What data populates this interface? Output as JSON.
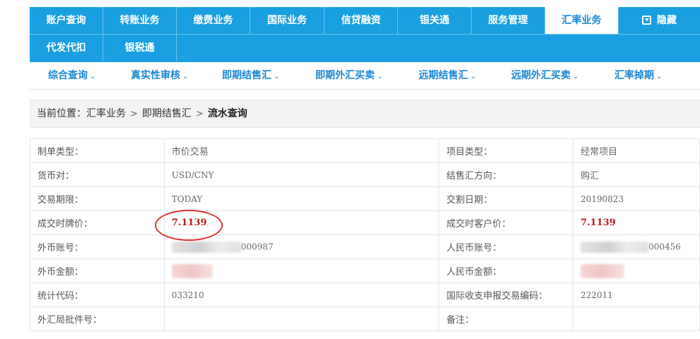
{
  "top_tabs": [
    {
      "label": "账户查询"
    },
    {
      "label": "转账业务"
    },
    {
      "label": "缴费业务"
    },
    {
      "label": "国际业务"
    },
    {
      "label": "信贷融资"
    },
    {
      "label": "银关通"
    },
    {
      "label": "服务管理"
    },
    {
      "label": "汇率业务",
      "active": true
    },
    {
      "label": "隐藏",
      "icon": "collapse-icon"
    },
    {
      "label": "代发代扣"
    },
    {
      "label": "银税通"
    }
  ],
  "sub_nav": [
    {
      "label": "综合查询"
    },
    {
      "label": "真实性审核"
    },
    {
      "label": "即期结售汇"
    },
    {
      "label": "即期外汇买卖"
    },
    {
      "label": "远期结售汇"
    },
    {
      "label": "远期外汇买卖"
    },
    {
      "label": "汇率掉期"
    }
  ],
  "breadcrumb": {
    "prefix": "当前位置：",
    "items": [
      "汇率业务",
      "即期结售汇"
    ],
    "current": "流水查询"
  },
  "detail_rows": [
    {
      "l1": "制单类型：",
      "v1": "市价交易",
      "l2": "项目类型：",
      "v2": "经常项目"
    },
    {
      "l1": "货币对：",
      "v1": "USD/CNY",
      "l2": "结售汇方向：",
      "v2": "购汇"
    },
    {
      "l1": "交易期限：",
      "v1": "TODAY",
      "l2": "交割日期：",
      "v2": "20190823"
    },
    {
      "l1": "成交时牌价：",
      "v1": "7.1139",
      "l2": "成交时客户价：",
      "v2": "7.1139"
    },
    {
      "l1": "外币账号：",
      "v1": "000987",
      "l2": "人民币账号：",
      "v2": "000456"
    },
    {
      "l1": "外币金额：",
      "v1": "",
      "l2": "人民币金额：",
      "v2": ""
    },
    {
      "l1": "统计代码：",
      "v1": "033210",
      "l2": "国际收支申报交易编码：",
      "v2": "222011"
    },
    {
      "l1": "外汇局批件号：",
      "v1": "",
      "l2": "备注：",
      "v2": ""
    }
  ],
  "colors": {
    "nav_blue": "#1a9fe0",
    "link_blue": "#1a88d6",
    "price_red": "#b51d1d",
    "annotation_red": "#e0312f"
  }
}
